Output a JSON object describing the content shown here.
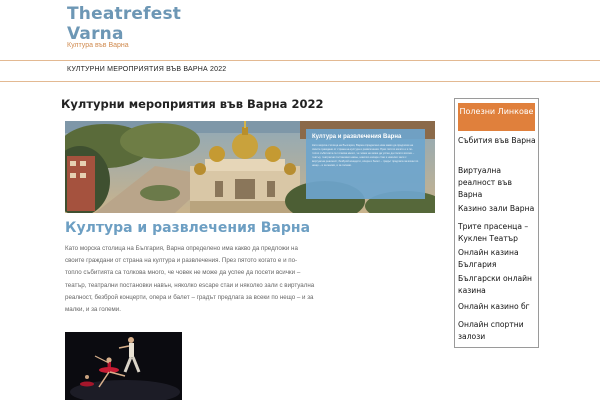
{
  "site": {
    "title_line1": "Theatrefest",
    "title_line2": "Varna",
    "tagline": "Култура във Варна"
  },
  "nav": {
    "items": [
      {
        "label": "КУЛТУРНИ МЕРОПРИЯТИЯ ВЪВ ВАРНА 2022"
      }
    ]
  },
  "main": {
    "title": "Културни мероприятия във Варна 2022",
    "hero": {
      "box_title": "Култура и развлечения Варна",
      "box_text": "Като морска столица на България, Варна определено има какво да предложи на своите граждани от страна на култура и развлечения. През пятото когато е и по- топло събитията са толкова много, че човек не може да успее да посети всички – театър, театрални постановки навън, няколко escape стаи и няколко зали с виртуална реалност, безброй концерти, опера и балет – градът предлага за всеки по нещо – и за малки, и за големи."
    },
    "subtitle": "Култура и развлечения Варна",
    "paragraph": "Като морска столица на България, Варна определено има какво да предложи на своите граждани от страна на култура и развлечения. През пятото когато е и по- топло събитията са толкова много, че човек не може да успее да посети всички – театър, театрални постановки навън, няколко escape стаи и няколко зали с виртуална реалност, безброй концерти, опера и балет – градът предлага за всеки по нещо – и за малки, и за големи."
  },
  "sidebar": {
    "title": "Полезни Линкове",
    "links": [
      {
        "label": "Събития във Варна"
      },
      {
        "label": "Виртуална реалност във Варна"
      },
      {
        "label": "Казино зали Варна"
      },
      {
        "label": "Трите прасенца – Куклен Театър"
      },
      {
        "label": "Онлайн казина България"
      },
      {
        "label": "Български онлайн казина"
      },
      {
        "label": "Онлайн казино бг"
      },
      {
        "label": "Онлайн спортни залози"
      }
    ]
  },
  "colors": {
    "title_blue": "#6d97b5",
    "tagline_orange": "#d08a4e",
    "accent_orange": "#e0803c",
    "subtitle_blue": "#6d9fc3"
  }
}
